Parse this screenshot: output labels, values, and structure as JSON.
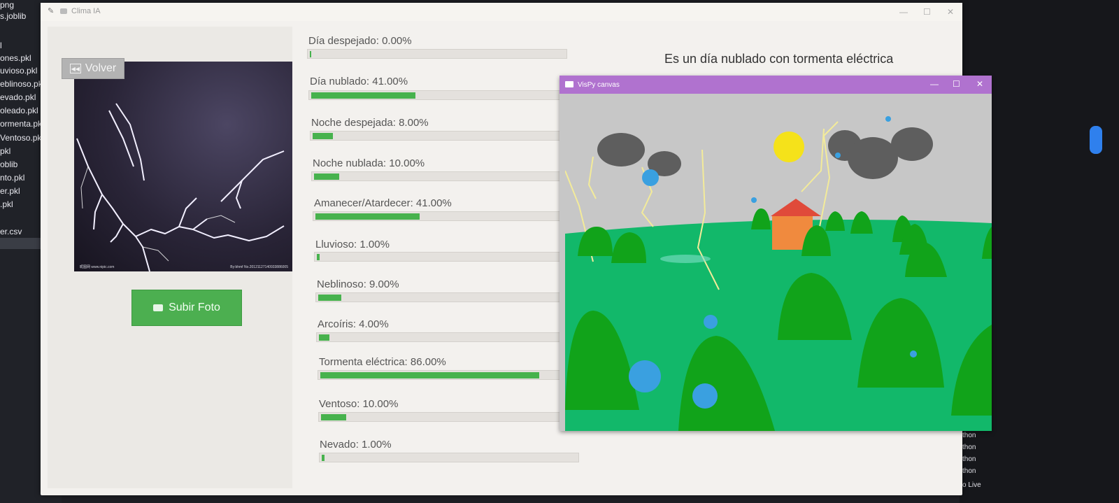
{
  "editor": {
    "files": [
      "png",
      "s.joblib",
      "l",
      "ones.pkl",
      "uvioso.pkl",
      "eblinoso.pk",
      "evado.pkl",
      "oleado.pkl",
      "ormenta.pkl",
      "Ventoso.pkl",
      "pkl",
      "oblib",
      "nto.pkl",
      "er.pkl",
      ".pkl",
      "er.csv"
    ]
  },
  "terminal": {
    "lines": [
      "thon",
      "thon",
      "thon",
      "thon",
      "thon"
    ],
    "live_label": "o Live"
  },
  "window": {
    "title": "Clima IA",
    "minimize": "—",
    "maximize": "☐",
    "close": "✕"
  },
  "left_panel": {
    "back_button": "Volver",
    "upload_button": "Subir Foto",
    "photo_caption_left": "昵图网 www.nipic.com",
    "photo_caption_right": "By:bhmf No.20121127140933886005"
  },
  "probabilities": [
    {
      "label": "Día despejado: 0.00%",
      "value": 0.0
    },
    {
      "label": "Día nublado: 41.00%",
      "value": 41.0
    },
    {
      "label": "Noche despejada: 8.00%",
      "value": 8.0
    },
    {
      "label": "Noche nublada: 10.00%",
      "value": 10.0
    },
    {
      "label": "Amanecer/Atardecer: 41.00%",
      "value": 41.0
    },
    {
      "label": "Lluvioso: 1.00%",
      "value": 1.0
    },
    {
      "label": "Neblinoso: 9.00%",
      "value": 9.0
    },
    {
      "label": "Arcoíris: 4.00%",
      "value": 4.0
    },
    {
      "label": "Tormenta eléctrica: 86.00%",
      "value": 86.0
    },
    {
      "label": "Ventoso: 10.00%",
      "value": 10.0
    },
    {
      "label": "Nevado: 1.00%",
      "value": 1.0
    }
  ],
  "result": "Es un día nublado con tormenta eléctrica",
  "vispy": {
    "title": "VisPy canvas",
    "minimize": "—",
    "maximize": "☐",
    "close": "✕",
    "colors": {
      "sky": "#c7c7c7",
      "grass": "#12b86a",
      "tree": "#11a31a",
      "sun": "#f5e21a",
      "cloud": "#5e5e5e",
      "roof": "#e04a3a",
      "house": "#f08a3e",
      "drop": "#3aa0e0"
    }
  }
}
